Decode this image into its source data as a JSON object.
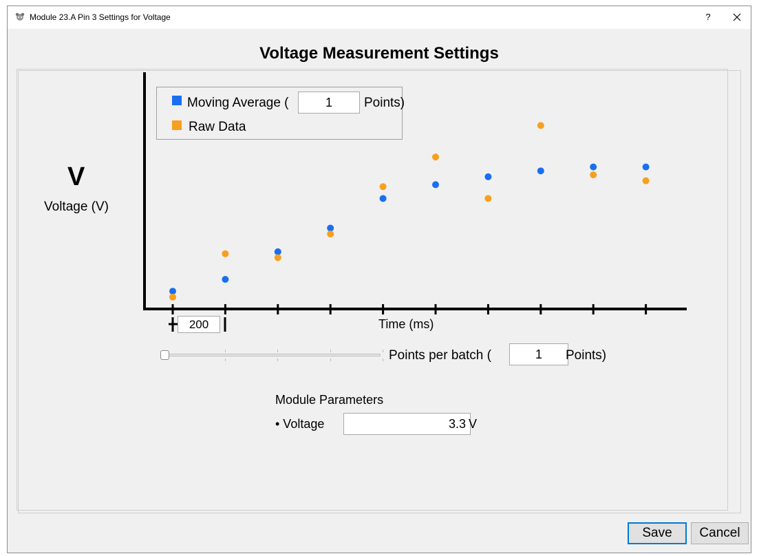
{
  "window": {
    "title": "Module 23.A Pin 3 Settings for Voltage",
    "help_label": "?",
    "close_label": "✕"
  },
  "header": {
    "title": "Voltage Measurement Settings"
  },
  "chart": {
    "unit_symbol": "V",
    "unit_label": "Voltage (V)",
    "xlabel": "Time (ms)",
    "legend": {
      "moving_average_prefix": "Moving Average (",
      "moving_average_points": "1",
      "moving_average_suffix": "Points)",
      "raw_data_label": "Raw Data"
    },
    "time_scale_value": "200"
  },
  "chart_data": {
    "type": "scatter",
    "xlabel": "Time (ms)",
    "ylabel": "Voltage (V)",
    "x": [
      1,
      2,
      3,
      4,
      5,
      6,
      7,
      8,
      9,
      10
    ],
    "series": [
      {
        "name": "Moving Average",
        "color": "#1a6ff0",
        "values": [
          0.9,
          1.5,
          2.9,
          4.1,
          5.6,
          6.3,
          6.7,
          7.0,
          7.2,
          7.2
        ]
      },
      {
        "name": "Raw Data",
        "color": "#f7a01e",
        "values": [
          0.6,
          2.8,
          2.6,
          3.8,
          6.2,
          7.7,
          5.6,
          9.3,
          6.8,
          6.5
        ]
      }
    ],
    "ylim": [
      0,
      12
    ],
    "grid": false,
    "legend_position": "top-left"
  },
  "batch": {
    "label": "Points per batch (",
    "value": "1",
    "suffix": "Points)"
  },
  "module_params": {
    "heading": "Module Parameters",
    "voltage_label": "• Voltage",
    "voltage_value": "3.3",
    "voltage_unit": "V"
  },
  "buttons": {
    "save": "Save",
    "cancel": "Cancel"
  },
  "colors": {
    "accent": "#0078d7",
    "moving_average": "#1a6ff0",
    "raw_data": "#f7a01e"
  }
}
